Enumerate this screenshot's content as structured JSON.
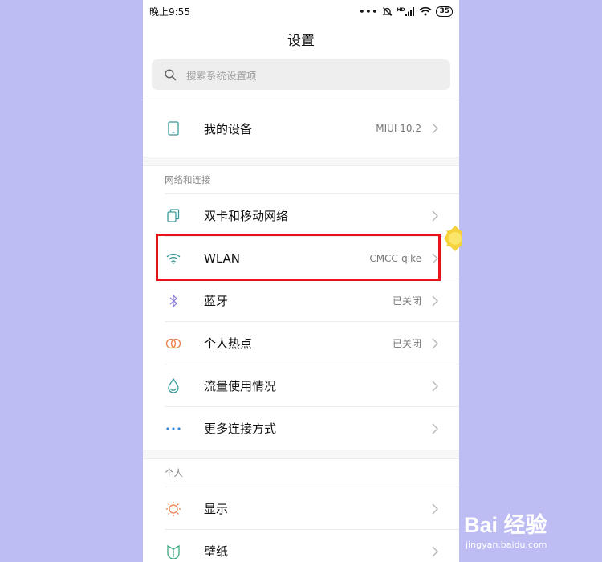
{
  "status_bar": {
    "time": "晚上9:55",
    "signal_label": "HD",
    "battery": "35"
  },
  "page": {
    "title": "设置"
  },
  "search": {
    "placeholder": "搜索系统设置项"
  },
  "device": {
    "label": "我的设备",
    "value": "MIUI 10.2"
  },
  "sections": {
    "network_header": "网络和连接",
    "personal_header": "个人"
  },
  "network_items": [
    {
      "label": "双卡和移动网络",
      "value": "",
      "icon": "sim-card-icon"
    },
    {
      "label": "WLAN",
      "value": "CMCC-qike",
      "icon": "wifi-icon"
    },
    {
      "label": "蓝牙",
      "value": "已关闭",
      "icon": "bluetooth-icon"
    },
    {
      "label": "个人热点",
      "value": "已关闭",
      "icon": "hotspot-icon"
    },
    {
      "label": "流量使用情况",
      "value": "",
      "icon": "data-usage-icon"
    },
    {
      "label": "更多连接方式",
      "value": "",
      "icon": "more-icon"
    }
  ],
  "personal_items": [
    {
      "label": "显示",
      "value": "",
      "icon": "display-icon"
    },
    {
      "label": "壁纸",
      "value": "",
      "icon": "wallpaper-icon"
    }
  ],
  "watermark": {
    "brand": "Bai 经验",
    "url": "jingyan.baidu.com"
  },
  "colors": {
    "background": "#bdbdf3",
    "highlight_border": "#e8121b",
    "icon_teal": "#3a9a9a",
    "chevron": "#b5b5b5"
  }
}
